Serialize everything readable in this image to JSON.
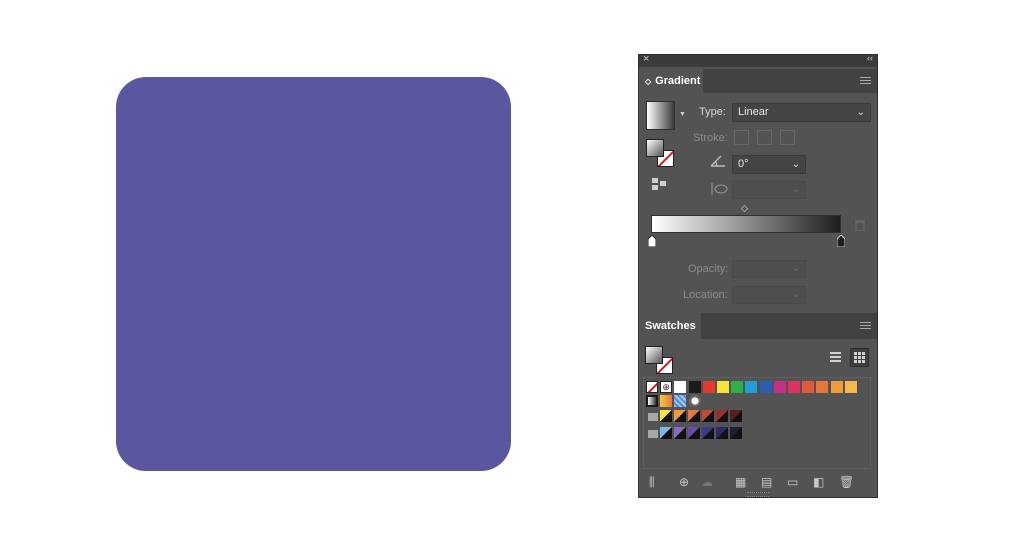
{
  "canvas": {
    "shape_color": "#5a56a0"
  },
  "panel": {
    "close_glyph": "×",
    "collapse_glyph": "‹‹",
    "gradient": {
      "tab_label": "Gradient",
      "tab_arrows": "◇",
      "type_label": "Type:",
      "type_value": "Linear",
      "stroke_label": "Stroke:",
      "angle_value": "0°",
      "opacity_label": "Opacity:",
      "location_label": "Location:"
    },
    "swatches": {
      "tab_label": "Swatches",
      "row1": [
        "none",
        "registration",
        "#ffffff",
        "#1b1b1b",
        "#e23a2e",
        "#f6e43a",
        "#2db24a",
        "#1f9ed9",
        "#2a5fb8",
        "#c43184",
        "#e3315e",
        "#e35a3a",
        "#e8763a",
        "#f09a3a",
        "#f5b84a"
      ],
      "row2": [
        "gradient-gray",
        "gradient-orange",
        "gradient-blue",
        "pattern-dots"
      ],
      "group1": [
        "#f6e43a",
        "#f09a3a",
        "#e8763a",
        "#c44a2e",
        "#9a2e2e",
        "#5a1e1e"
      ],
      "group2": [
        "#7ab8e8",
        "#8a6ac8",
        "#6a4aa8",
        "#3a3a8a",
        "#2a2a6a",
        "#1e1e3a"
      ]
    }
  }
}
